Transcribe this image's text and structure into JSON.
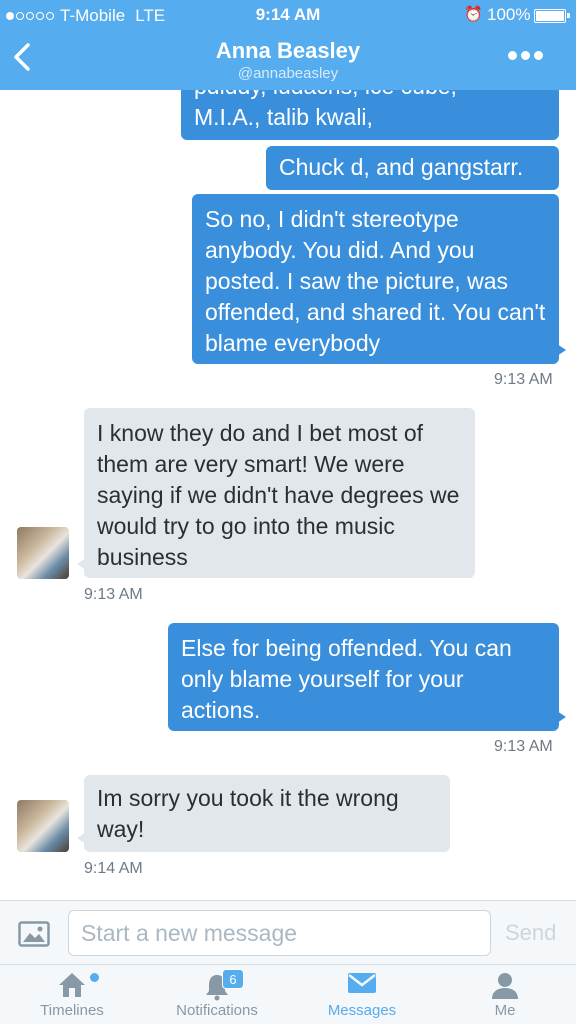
{
  "status_bar": {
    "carrier": "T-Mobile",
    "network": "LTE",
    "time": "9:14 AM",
    "battery": "100%"
  },
  "header": {
    "title": "Anna Beasley",
    "handle": "@annabeasley"
  },
  "messages": [
    {
      "dir": "out",
      "text": "pdiddy, ludacris, ice cube,\nM.I.A., talib kwali,"
    },
    {
      "dir": "out",
      "text": "Chuck d, and gangstarr."
    },
    {
      "dir": "out",
      "text": "So no, I didn't stereotype anybody. You did. And you posted. I saw the picture, was offended, and shared it. You can't blame everybody"
    },
    {
      "dir": "in",
      "text": "I know they do and I bet most of them are very smart! We were saying if we didn't have degrees we would try to go into the music business"
    },
    {
      "dir": "out",
      "text": "Else for being offended. You can only blame yourself for your actions."
    },
    {
      "dir": "in",
      "text": "Im sorry you took it the wrong way!"
    }
  ],
  "timestamps": [
    "9:13 AM",
    "9:13 AM",
    "9:13 AM",
    "9:14 AM"
  ],
  "composer": {
    "placeholder": "Start a new message",
    "send_label": "Send"
  },
  "tabs": [
    {
      "label": "Timelines",
      "icon": "home-icon"
    },
    {
      "label": "Notifications",
      "icon": "bell-icon",
      "badge": "6"
    },
    {
      "label": "Messages",
      "icon": "envelope-icon",
      "active": true
    },
    {
      "label": "Me",
      "icon": "person-icon"
    }
  ],
  "colors": {
    "accent": "#55acee",
    "outgoing_bubble": "#3a8fdc",
    "incoming_bubble": "#e2e7eb"
  }
}
